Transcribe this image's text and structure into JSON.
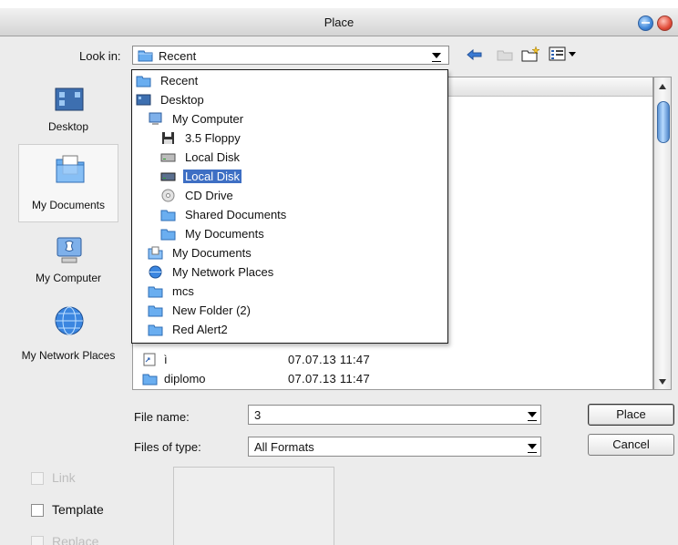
{
  "window": {
    "title": "Place"
  },
  "look_in": {
    "label": "Look in:",
    "value": "Recent"
  },
  "sidebar": {
    "items": [
      {
        "label": "Desktop",
        "icon": "desktop-icon"
      },
      {
        "label": "My Documents",
        "icon": "my-documents-icon"
      },
      {
        "label": "My Computer",
        "icon": "my-computer-icon"
      },
      {
        "label": "My Network Places",
        "icon": "network-globe-icon"
      }
    ]
  },
  "dropdown": {
    "items": [
      {
        "label": "Recent",
        "icon": "folder-icon"
      },
      {
        "label": "Desktop",
        "icon": "desktop-icon"
      },
      {
        "label": "My Computer",
        "icon": "my-computer-icon"
      },
      {
        "label": "3.5 Floppy",
        "icon": "floppy-icon"
      },
      {
        "label": "Local Disk",
        "icon": "disk-icon"
      },
      {
        "label": "Local Disk",
        "icon": "disk-icon",
        "selected": true
      },
      {
        "label": "CD Drive",
        "icon": "cd-icon"
      },
      {
        "label": "Shared Documents",
        "icon": "folder-icon"
      },
      {
        "label": "My Documents",
        "icon": "folder-icon"
      },
      {
        "label": "My Documents",
        "icon": "my-documents-icon"
      },
      {
        "label": "My Network Places",
        "icon": "network-globe-icon"
      },
      {
        "label": "mcs",
        "icon": "folder-icon"
      },
      {
        "label": "New Folder (2)",
        "icon": "folder-icon"
      },
      {
        "label": "Red Alert2",
        "icon": "folder-icon"
      }
    ]
  },
  "files": [
    {
      "name": "ì",
      "date": "07.07.13 11:47",
      "icon": "shortcut-file-icon"
    },
    {
      "name": "diplomo",
      "date": "07.07.13 11:47",
      "icon": "folder-icon"
    }
  ],
  "file_name": {
    "label": "File name:",
    "value": "3"
  },
  "file_type": {
    "label": "Files of type:",
    "value": "All Formats"
  },
  "buttons": {
    "place": "Place",
    "cancel": "Cancel"
  },
  "options": {
    "link": "Link",
    "template": "Template",
    "replace": "Replace"
  },
  "colors": {
    "selection": "#3e6fc4",
    "folder": "#6aaef0"
  }
}
